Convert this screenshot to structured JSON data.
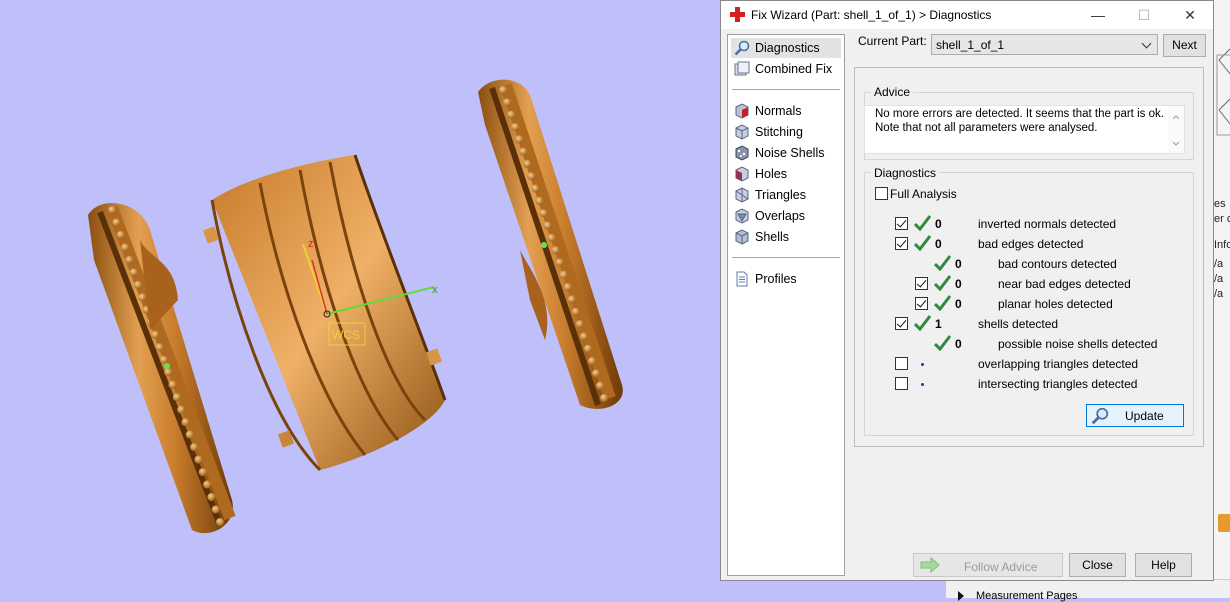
{
  "viewport": {
    "axis_labels": {
      "x": "x",
      "z": "z"
    },
    "wcs_label": "WCS"
  },
  "right_strip": {
    "fragments": [
      "es",
      "er o",
      "Info",
      "/a",
      "/a",
      "/a"
    ]
  },
  "bottom_strip": {
    "label": "Measurement Pages"
  },
  "dialog": {
    "title": "Fix Wizard (Part: shell_1_of_1) > Diagnostics",
    "window_buttons": {
      "minimize": "—",
      "maximize": "☐",
      "close": "✕"
    },
    "nav": {
      "items": [
        {
          "label": "Diagnostics",
          "icon": "magnifier-icon",
          "active": true
        },
        {
          "label": "Combined Fix",
          "icon": "combined-fix-icon"
        },
        {
          "label": "Normals",
          "icon": "normals-cube-icon"
        },
        {
          "label": "Stitching",
          "icon": "stitching-cube-icon"
        },
        {
          "label": "Noise Shells",
          "icon": "noise-shells-icon"
        },
        {
          "label": "Holes",
          "icon": "holes-cube-icon"
        },
        {
          "label": "Triangles",
          "icon": "triangles-cube-icon"
        },
        {
          "label": "Overlaps",
          "icon": "overlaps-cube-icon"
        },
        {
          "label": "Shells",
          "icon": "shells-cube-icon"
        },
        {
          "label": "Profiles",
          "icon": "document-icon"
        }
      ]
    },
    "current_part": {
      "label": "Current Part:",
      "value": "shell_1_of_1"
    },
    "next_button": "Next",
    "advice": {
      "title": "Advice",
      "text": "No more errors are detected. It seems that the part is ok. Note that not all parameters were analysed."
    },
    "diagnostics": {
      "title": "Diagnostics",
      "full_analysis": {
        "label": "Full Analysis",
        "checked": false
      },
      "rows": [
        {
          "label": "inverted normals detected",
          "count": "0",
          "checked": true,
          "status": "ok",
          "indent": 0
        },
        {
          "label": "bad edges detected",
          "count": "0",
          "checked": true,
          "status": "ok",
          "indent": 0
        },
        {
          "label": "bad contours detected",
          "count": "0",
          "checked": null,
          "status": "ok",
          "indent": 1
        },
        {
          "label": "near bad edges detected",
          "count": "0",
          "checked": true,
          "status": "ok",
          "indent": 1
        },
        {
          "label": "planar holes detected",
          "count": "0",
          "checked": true,
          "status": "ok",
          "indent": 1
        },
        {
          "label": "shells detected",
          "count": "1",
          "checked": true,
          "status": "ok",
          "indent": 0
        },
        {
          "label": "possible noise shells detected",
          "count": "0",
          "checked": null,
          "status": "ok",
          "indent": 1
        },
        {
          "label": "overlapping triangles detected",
          "count": "",
          "checked": false,
          "status": "pending",
          "indent": 0
        },
        {
          "label": "intersecting triangles detected",
          "count": "",
          "checked": false,
          "status": "pending",
          "indent": 0
        }
      ],
      "update_button": "Update"
    },
    "footer": {
      "follow_advice": "Follow Advice",
      "close": "Close",
      "help": "Help"
    },
    "colors": {
      "tick": "#2e8b3e",
      "ring": "#d98f3a",
      "viewport_bg": "#bfbff9"
    }
  }
}
